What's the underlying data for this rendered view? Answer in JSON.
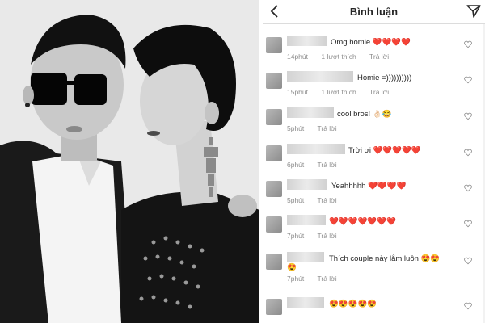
{
  "header": {
    "title": "Bình luận"
  },
  "comments": [
    {
      "text": "Omg homie ❤️❤️❤️❤️",
      "time": "14phút",
      "likes": "1 lượt thích",
      "reply": "Trả lời"
    },
    {
      "text": "Homie =))))))))))",
      "time": "15phút",
      "likes": "1 lượt thích",
      "reply": "Trả lời"
    },
    {
      "text": "cool bros! 👌🏻😂",
      "time": "5phút",
      "likes": "",
      "reply": "Trả lời"
    },
    {
      "text": "Trời ơi ❤️❤️❤️❤️❤️",
      "time": "6phút",
      "likes": "",
      "reply": "Trả lời"
    },
    {
      "text": "Yeahhhhh ❤️❤️❤️❤️",
      "time": "5phút",
      "likes": "",
      "reply": "Trả lời"
    },
    {
      "text": "❤️❤️❤️❤️❤️❤️❤️",
      "time": "7phút",
      "likes": "",
      "reply": "Trả lời"
    },
    {
      "text": "Thích couple này lắm luôn 😍😍",
      "text_cont": "😍",
      "time": "7phút",
      "likes": "",
      "reply": "Trả lời"
    },
    {
      "text": "😍😍😍😍😍",
      "time": "",
      "likes": "",
      "reply": ""
    }
  ]
}
